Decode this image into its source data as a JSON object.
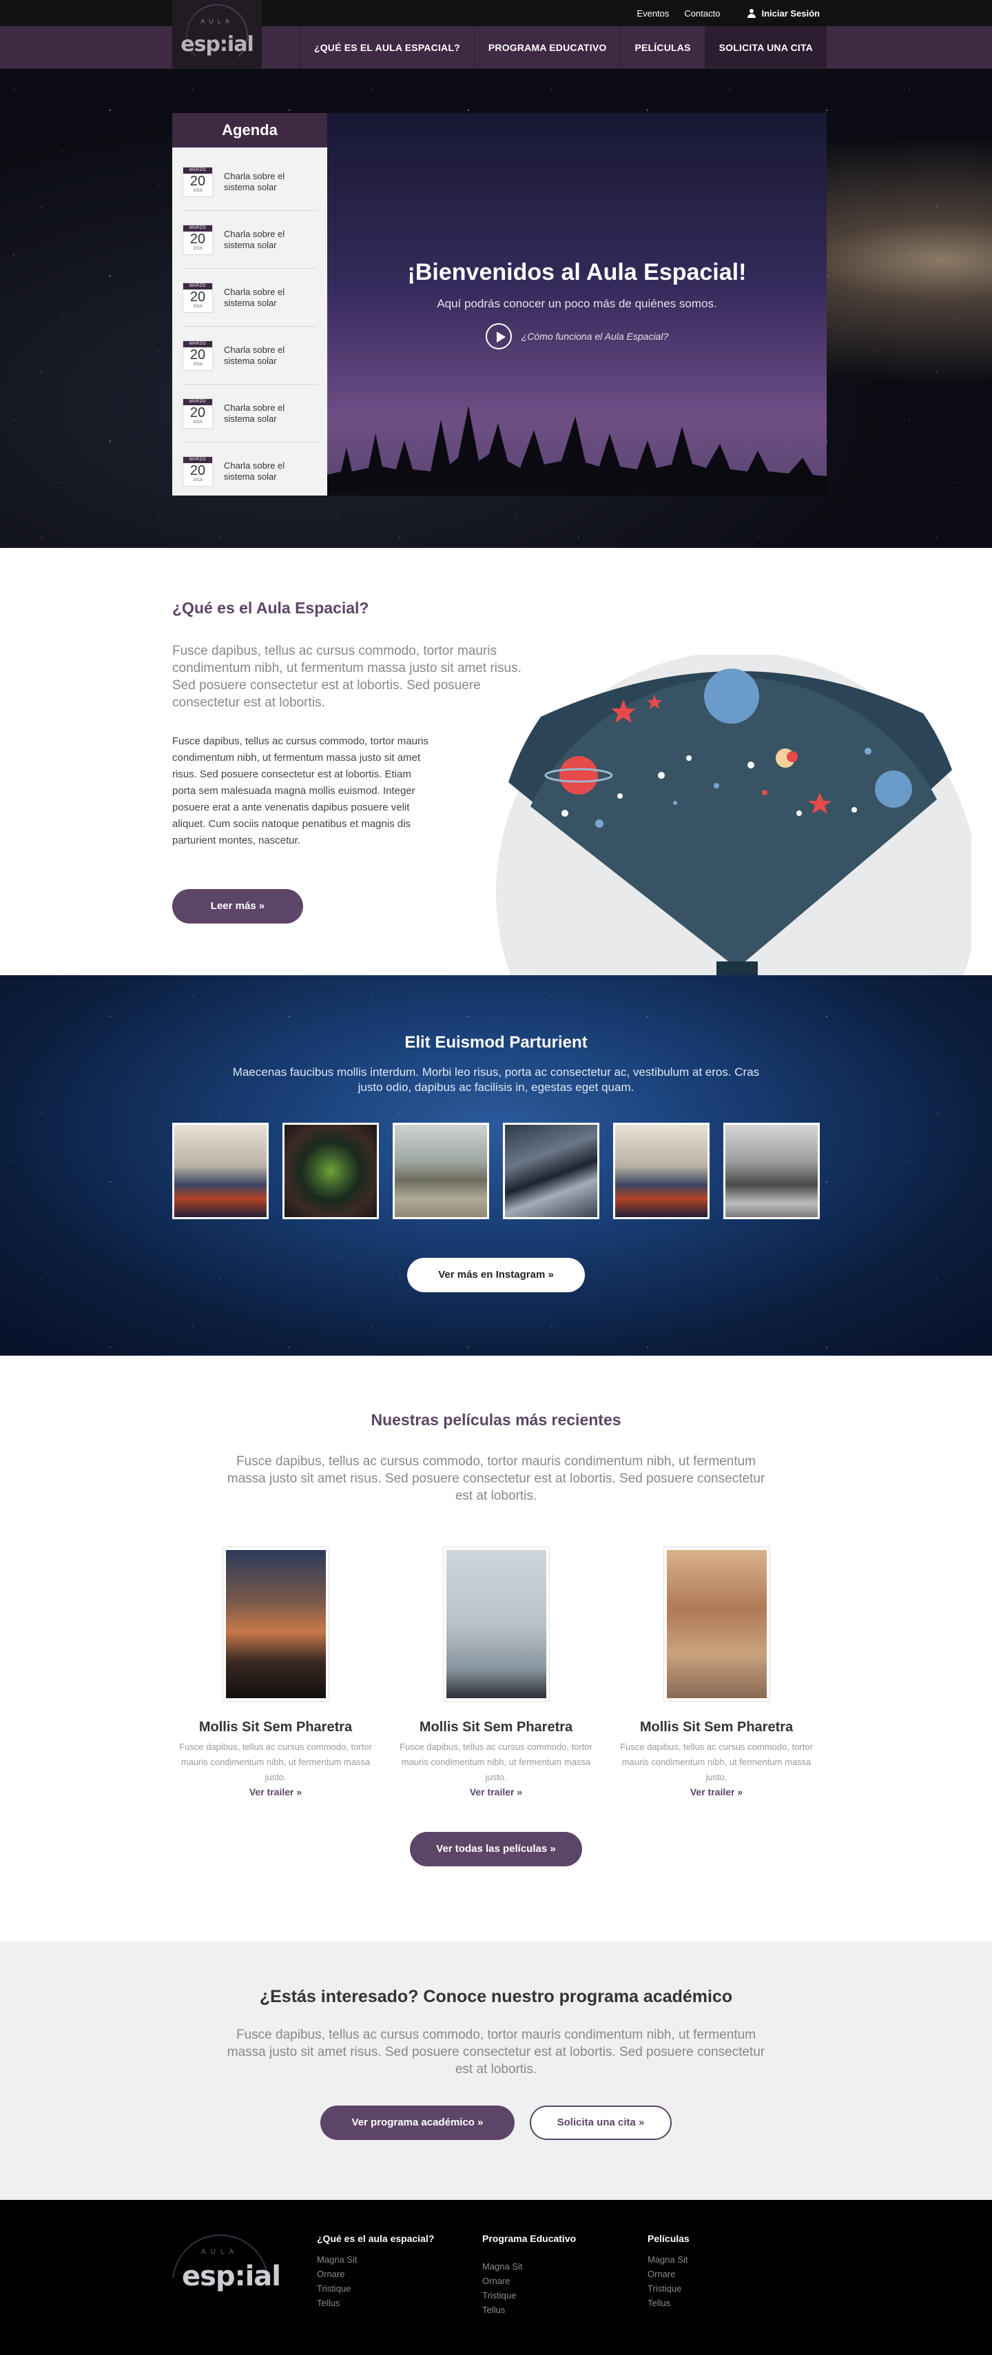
{
  "topbar": {
    "links": [
      "Eventos",
      "Contacto"
    ],
    "login": "Iniciar Sesión"
  },
  "logo": {
    "text": "esp:ial",
    "sub": "AULA"
  },
  "nav": [
    "¿QUÉ ES EL AULA ESPACIAL?",
    "PROGRAMA EDUCATIVO",
    "PELÍCULAS",
    "SOLICITA UNA CITA"
  ],
  "agenda": {
    "title": "Agenda",
    "items": [
      {
        "month": "MARZO",
        "day": "20",
        "year": "2016",
        "title": "Charla sobre el sistema solar"
      },
      {
        "month": "MARZO",
        "day": "20",
        "year": "2016",
        "title": "Charla sobre el sistema solar"
      },
      {
        "month": "MARZO",
        "day": "20",
        "year": "2016",
        "title": "Charla sobre el sistema solar"
      },
      {
        "month": "MARZO",
        "day": "20",
        "year": "2016",
        "title": "Charla sobre el sistema solar"
      },
      {
        "month": "MARZO",
        "day": "20",
        "year": "2016",
        "title": "Charla sobre el sistema solar"
      },
      {
        "month": "MARZO",
        "day": "20",
        "year": "2016",
        "title": "Charla sobre el sistema solar"
      }
    ]
  },
  "hero": {
    "title": "¡Bienvenidos al Aula Espacial!",
    "subtitle": "Aquí podrás conocer un poco más de quiénes somos.",
    "video_link": "¿Cómo funciona el Aula Espacial?"
  },
  "about": {
    "title": "¿Qué es el Aula Espacial?",
    "lead": "Fusce dapibus, tellus ac cursus commodo, tortor mauris condimentum nibh, ut fermentum massa justo sit amet risus. Sed posuere consectetur est at lobortis. Sed posuere consectetur est at lobortis.",
    "body": "Fusce dapibus, tellus ac cursus commodo, tortor mauris condimentum nibh, ut fermentum massa justo sit amet risus. Sed posuere consectetur est at lobortis. Etiam porta sem malesuada magna mollis euismod. Integer posuere erat a ante venenatis dapibus posuere velit aliquet. Cum sociis natoque penatibus et magnis dis parturient montes, nascetur.",
    "button": "Leer más »"
  },
  "instagram": {
    "title": "Elit Euismod Parturient",
    "text": "Maecenas faucibus mollis interdum. Morbi leo risus, porta ac consectetur ac, vestibulum at eros. Cras justo odio, dapibus ac facilisis in, egestas eget quam.",
    "button": "Ver más en Instagram »"
  },
  "movies": {
    "title": "Nuestras películas más recientes",
    "lead": "Fusce dapibus, tellus ac cursus commodo, tortor mauris condimentum nibh, ut fermentum massa justo sit amet risus. Sed posuere consectetur est at lobortis. Sed posuere consectetur est at lobortis.",
    "items": [
      {
        "title": "Mollis Sit Sem Pharetra",
        "text": "Fusce dapibus, tellus ac cursus commodo, tortor mauris condimentum nibh, ut fermentum massa justo.",
        "link": "Ver trailer »"
      },
      {
        "title": "Mollis Sit Sem Pharetra",
        "text": "Fusce dapibus, tellus ac cursus commodo, tortor mauris condimentum nibh, ut fermentum massa justo.",
        "link": "Ver trailer »"
      },
      {
        "title": "Mollis Sit Sem Pharetra",
        "text": "Fusce dapibus, tellus ac cursus commodo, tortor mauris condimentum nibh, ut fermentum massa justo.",
        "link": "Ver trailer »"
      }
    ],
    "button": "Ver todas las películas »"
  },
  "cta": {
    "title": "¿Estás interesado? Conoce nuestro programa académico",
    "lead": "Fusce dapibus, tellus ac cursus commodo, tortor mauris condimentum nibh, ut fermentum massa justo sit amet risus. Sed posuere consectetur est at lobortis. Sed posuere consectetur est at lobortis.",
    "primary": "Ver programa académico »",
    "secondary": "Solicita una cita »"
  },
  "footer": {
    "logo_text": "esp:ial",
    "logo_sub": "AULA",
    "columns": [
      {
        "title": "¿Qué es el aula espacial?",
        "links": [
          "Magna Sit",
          "Ornare",
          "Tristique",
          "Tellus"
        ]
      },
      {
        "title": "Programa Educativo",
        "links": [
          "Magna Sit",
          "Ornare",
          "Tristique",
          "Tellus"
        ]
      },
      {
        "title": "Películas",
        "links": [
          "Magna Sit",
          "Ornare",
          "Tristique",
          "Tellus"
        ]
      }
    ]
  },
  "colors": {
    "brand": "#5d4567",
    "nav": "#3f2a44",
    "footer": "#000000",
    "cta_bg": "#f0f0f0"
  }
}
